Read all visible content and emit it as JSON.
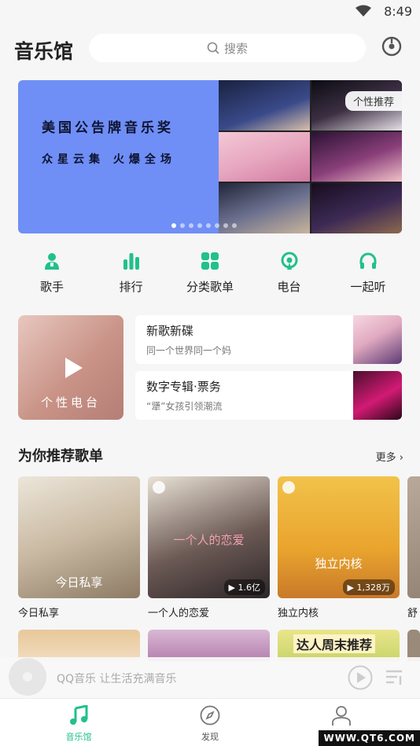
{
  "status_bar": {
    "time": "8:49"
  },
  "header": {
    "title": "音乐馆",
    "search_placeholder": "搜索"
  },
  "banner": {
    "line1": "美国公告牌音乐奖",
    "line2": "众星云集 火爆全场",
    "tag": "个性推荐",
    "dot_count": 8,
    "active_dot": 0
  },
  "quick_nav": [
    {
      "label": "歌手",
      "icon": "singer-icon"
    },
    {
      "label": "排行",
      "icon": "chart-icon"
    },
    {
      "label": "分类歌单",
      "icon": "category-icon"
    },
    {
      "label": "电台",
      "icon": "radio-icon"
    },
    {
      "label": "一起听",
      "icon": "headphones-icon"
    }
  ],
  "radio_card": {
    "label": "个性电台"
  },
  "album_cards": [
    {
      "title": "新歌新碟",
      "subtitle": "同一个世界同一个妈"
    },
    {
      "title": "数字专辑·票务",
      "subtitle": "“犟”女孩引领潮流"
    }
  ],
  "recommend": {
    "title": "为你推荐歌单",
    "more": "更多",
    "playlists": [
      {
        "name": "今日私享",
        "overlay": "今日私享",
        "count": ""
      },
      {
        "name": "一个人的恋爱",
        "overlay": "一个人的恋爱",
        "count": "1.6亿"
      },
      {
        "name": "独立内核",
        "overlay": "独立内核",
        "count": "1,328万"
      },
      {
        "name": "舒",
        "overlay": "",
        "count": ""
      }
    ],
    "second_row_tag": "达人周末推荐"
  },
  "mini_player": {
    "text": "QQ音乐 让生活充满音乐"
  },
  "tab_bar": [
    {
      "label": "音乐馆",
      "icon": "music-note-icon",
      "active": true
    },
    {
      "label": "发现",
      "icon": "compass-icon",
      "active": false
    },
    {
      "label": "",
      "icon": "profile-icon",
      "active": false
    }
  ],
  "watermark": "WWW.QT6.COM",
  "colors": {
    "accent": "#22c08a",
    "banner_bg": "#6f8ff6"
  }
}
